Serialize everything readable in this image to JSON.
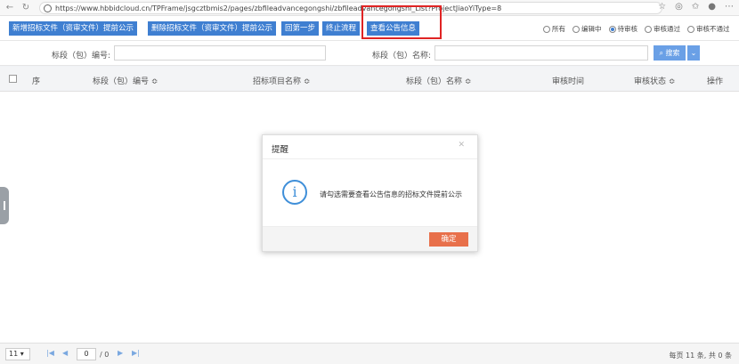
{
  "browser": {
    "url": "https://www.hbbidcloud.cn/TPFrame/jsgcztbmis2/pages/zbfileadvancegongshi/zbfileadvancegongshi_List?ProjectJiaoYiType=8"
  },
  "toolbar": {
    "buttons": [
      "新增招标文件（资审文件）提前公示",
      "删除招标文件（资审文件）提前公示",
      "回第一步",
      "终止流程",
      "查看公告信息"
    ],
    "radios": [
      "所有",
      "编辑中",
      "待审核",
      "审核通过",
      "审核不通过"
    ],
    "selected_radio": "待审核"
  },
  "search": {
    "code_label": "标段（包）编号:",
    "name_label": "标段（包）名称:",
    "search_button": "搜索"
  },
  "table": {
    "columns": [
      "序",
      "标段（包）编号 ≎",
      "招标项目名称 ≎",
      "标段（包）名称 ≎",
      "审核时间",
      "审核状态 ≎",
      "操作"
    ]
  },
  "modal": {
    "title": "提醒",
    "message": "请勾选需要查看公告信息的招标文件提前公示",
    "ok_label": "确定"
  },
  "pager": {
    "page_size": "11",
    "current_page": "0",
    "total_pages": "/ 0",
    "info": "每页 11 条, 共 0 条"
  }
}
